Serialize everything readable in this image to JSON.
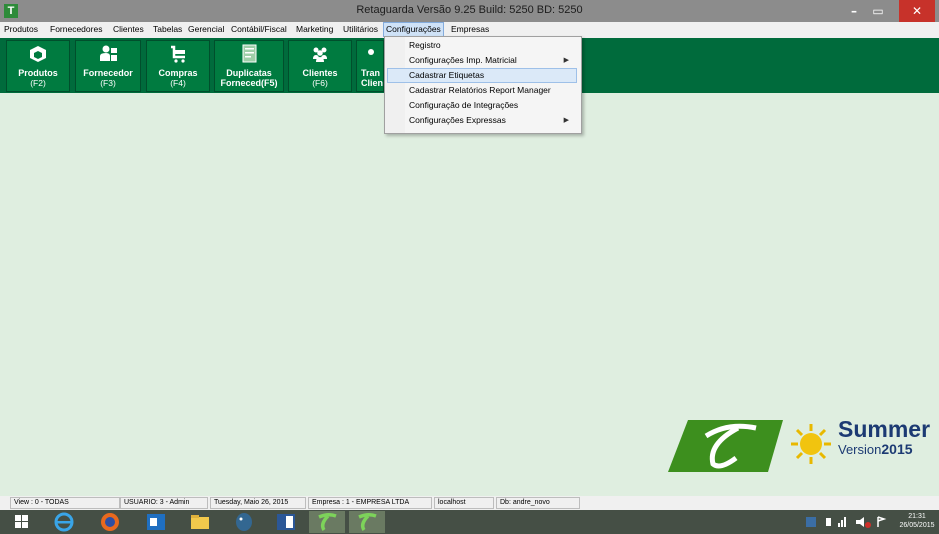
{
  "window": {
    "title": "Retaguarda Versão  9.25 Build: 5250 BD: 5250",
    "app_icon_letter": "T",
    "minimize_glyph": "–",
    "restore_glyph": "▭",
    "close_glyph": "✕"
  },
  "menubar": {
    "items": [
      "Produtos",
      "Fornecedores",
      "Clientes",
      "Tabelas",
      "Gerencial",
      "Contábil/Fiscal",
      "Marketing",
      "Utilitários",
      "Configurações",
      "Empresas"
    ],
    "active": "Configurações"
  },
  "toolbar": {
    "buttons": [
      {
        "label": "Produtos",
        "key": "(F2)",
        "icon": "box-icon"
      },
      {
        "label": "Fornecedor",
        "key": "(F3)",
        "icon": "supplier-icon"
      },
      {
        "label": "Compras",
        "key": "(F4)",
        "icon": "cart-icon"
      },
      {
        "label": "Duplicatas\nForneced(F5)",
        "key": "",
        "icon": "document-icon"
      },
      {
        "label": "Clientes",
        "key": "(F6)",
        "icon": "customers-icon"
      },
      {
        "label": "Tran\nClien",
        "key": "",
        "icon": "transaction-icon"
      }
    ]
  },
  "dropdown": {
    "items": [
      {
        "label": "Registro",
        "submenu": false
      },
      {
        "label": "Configurações Imp. Matricial",
        "submenu": true
      },
      {
        "label": "Cadastrar Etiquetas",
        "submenu": false,
        "highlighted": true
      },
      {
        "label": "Cadastrar Relatórios Report Manager",
        "submenu": false
      },
      {
        "label": "Configuração de Integrações",
        "submenu": false
      },
      {
        "label": "Configurações Expressas",
        "submenu": true
      }
    ],
    "arrow_glyph": "▶"
  },
  "logo": {
    "line1": "Summer",
    "line2_a": "Version",
    "line2_b": "2015"
  },
  "statusbar": {
    "view": "View : 0 - TODAS",
    "user": "USUARIO: 3 - Admin",
    "date": "Tuesday, Maio 26, 2015",
    "company": "Empresa : 1 - EMPRESA LTDA",
    "host": "localhost",
    "db": "Db: andre_novo"
  },
  "taskbar": {
    "time": "21:31",
    "date": "26/05/2015"
  },
  "colors": {
    "toolbar_green": "#006b3c",
    "button_green": "#007b40",
    "background": "#dfeee0",
    "logo_blue": "#1c3a73"
  }
}
